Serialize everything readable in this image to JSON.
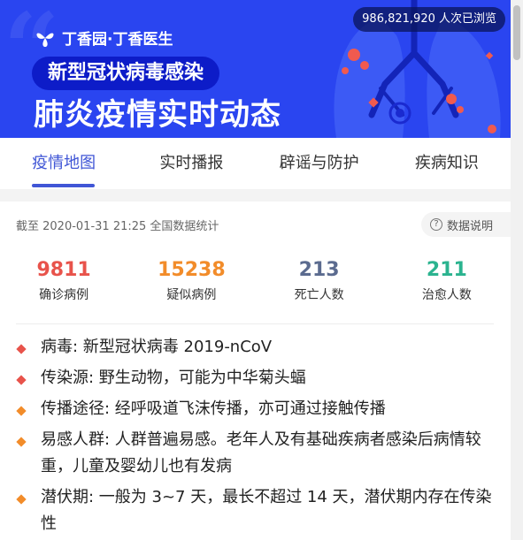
{
  "banner": {
    "brand": "丁香园·丁香医生",
    "views": "986,821,920 人次已浏览",
    "pill_title": "新型冠状病毒感染",
    "big_title": "肺炎疫情实时动态"
  },
  "tabs": [
    {
      "label": "疫情地图"
    },
    {
      "label": "实时播报"
    },
    {
      "label": "辟谣与防护"
    },
    {
      "label": "疾病知识"
    }
  ],
  "stats_header": {
    "as_of": "截至 2020-01-31 21:25 全国数据统计",
    "data_note": "数据说明"
  },
  "stats": [
    {
      "value": "9811",
      "label": "确诊病例",
      "color": "#e8534b"
    },
    {
      "value": "15238",
      "label": "疑似病例",
      "color": "#f28c2a"
    },
    {
      "value": "213",
      "label": "死亡人数",
      "color": "#5b6b8f"
    },
    {
      "value": "211",
      "label": "治愈人数",
      "color": "#2bb38f"
    }
  ],
  "info": [
    {
      "text": "病毒: 新型冠状病毒 2019-nCoV",
      "bullet_color": "#e8534b"
    },
    {
      "text": "传染源: 野生动物，可能为中华菊头蝠",
      "bullet_color": "#e8534b"
    },
    {
      "text": "传播途径: 经呼吸道飞沫传播，亦可通过接触传播",
      "bullet_color": "#f28c2a"
    },
    {
      "text": "易感人群: 人群普遍易感。老年人及有基础疾病者感染后病情较重，儿童及婴幼儿也有发病",
      "bullet_color": "#f28c2a"
    },
    {
      "text": "潜伏期: 一般为 3~7 天，最长不超过 14 天，潜伏期内存在传染性",
      "bullet_color": "#f28c2a"
    }
  ]
}
